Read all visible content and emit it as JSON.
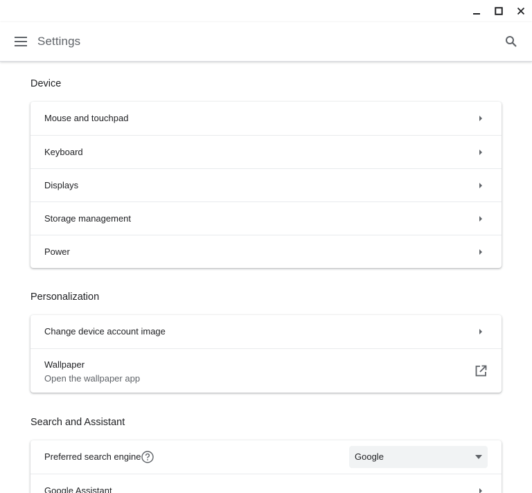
{
  "window": {
    "controls": {
      "minimize_icon": "minimize-icon",
      "maximize_icon": "maximize-icon",
      "close_icon": "close-icon"
    }
  },
  "toolbar": {
    "title": "Settings",
    "menu_icon": "hamburger-menu-icon",
    "search_icon": "search-icon"
  },
  "sections": {
    "device": {
      "title": "Device",
      "items": [
        {
          "label": "Mouse and touchpad"
        },
        {
          "label": "Keyboard"
        },
        {
          "label": "Displays"
        },
        {
          "label": "Storage management"
        },
        {
          "label": "Power"
        }
      ]
    },
    "personalization": {
      "title": "Personalization",
      "items": [
        {
          "label": "Change device account image"
        },
        {
          "label": "Wallpaper",
          "sublabel": "Open the wallpaper app"
        }
      ]
    },
    "search": {
      "title": "Search and Assistant",
      "preferred_engine": {
        "label": "Preferred search engine",
        "selected": "Google"
      },
      "assistant": {
        "label": "Google Assistant"
      }
    }
  },
  "colors": {
    "text_primary": "#202124",
    "text_secondary": "#5f6368",
    "divider": "#e8eaed",
    "select_bg": "#f1f3f4"
  }
}
